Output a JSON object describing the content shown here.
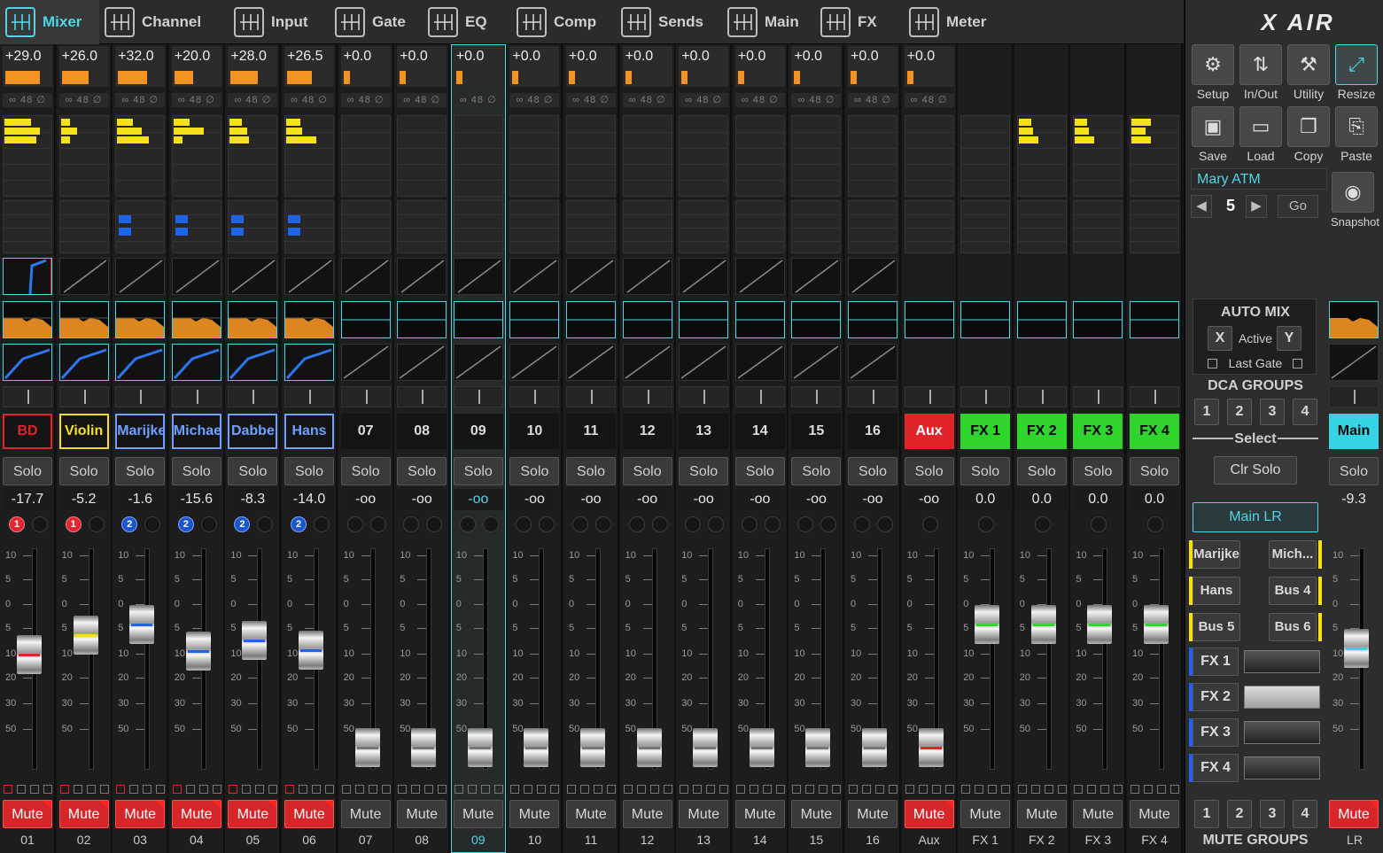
{
  "tabs": [
    {
      "label": "Mixer",
      "icon": "mixer-icon",
      "active": true
    },
    {
      "label": "Channel",
      "icon": "channel-icon"
    },
    {
      "label": "Input",
      "icon": "input-icon"
    },
    {
      "label": "Gate",
      "icon": "gate-icon"
    },
    {
      "label": "EQ",
      "icon": "eq-icon"
    },
    {
      "label": "Comp",
      "icon": "comp-icon"
    },
    {
      "label": "Sends",
      "icon": "sends-icon"
    },
    {
      "label": "Main",
      "icon": "main-icon"
    },
    {
      "label": "FX",
      "icon": "fx-icon"
    },
    {
      "label": "Meter",
      "icon": "meter-icon"
    }
  ],
  "colors": {
    "accent": "#4fd6e6",
    "red": "#e0242a",
    "yellow": "#f4e11c",
    "blue": "#1f63e6",
    "green": "#2fd52a",
    "orange": "#f39422"
  },
  "channel": {
    "phantom_label": "48",
    "solo_label": "Solo",
    "mute_label": "Mute",
    "fader_scale": [
      "10",
      "5",
      "0",
      "5",
      "10",
      "20",
      "30",
      "50"
    ]
  },
  "channels": [
    {
      "id": "01",
      "name": "BD",
      "trim": "+29.0",
      "fader": "-17.7",
      "fader_level": 0.62,
      "dca": "1",
      "dca_color": "red",
      "name_color": "#e0242a",
      "name_bg": "#141414",
      "muted": true,
      "fader_mark": "red",
      "mute_group": 1
    },
    {
      "id": "02",
      "name": "Violin",
      "trim": "+26.0",
      "fader": "-5.2",
      "fader_level": 0.75,
      "dca": "1",
      "dca_color": "red",
      "name_color": "#f4e11c",
      "name_bg": "#141414",
      "muted": true,
      "fader_mark": "yellow",
      "mute_group": 1
    },
    {
      "id": "03",
      "name": "Marijke",
      "trim": "+32.0",
      "fader": "-1.6",
      "fader_level": 0.82,
      "dca": "2",
      "dca_color": "blue",
      "name_color": "#6da0ff",
      "name_bg": "#141414",
      "muted": true,
      "fader_mark": "blue",
      "mute_group": 1
    },
    {
      "id": "04",
      "name": "Michael",
      "trim": "+20.0",
      "fader": "-15.6",
      "fader_level": 0.64,
      "dca": "2",
      "dca_color": "blue",
      "name_color": "#6da0ff",
      "name_bg": "#141414",
      "muted": true,
      "fader_mark": "blue",
      "mute_group": 1
    },
    {
      "id": "05",
      "name": "Dabbe",
      "trim": "+28.0",
      "fader": "-8.3",
      "fader_level": 0.71,
      "dca": "2",
      "dca_color": "blue",
      "name_color": "#6da0ff",
      "name_bg": "#141414",
      "muted": true,
      "fader_mark": "blue",
      "mute_group": 1
    },
    {
      "id": "06",
      "name": "Hans",
      "trim": "+26.5",
      "fader": "-14.0",
      "fader_level": 0.65,
      "dca": "2",
      "dca_color": "blue",
      "name_color": "#6da0ff",
      "name_bg": "#141414",
      "muted": true,
      "fader_mark": "blue",
      "mute_group": 1
    },
    {
      "id": "07",
      "name": "07",
      "trim": "+0.0",
      "fader": "-oo",
      "fader_level": 0,
      "muted": false
    },
    {
      "id": "08",
      "name": "08",
      "trim": "+0.0",
      "fader": "-oo",
      "fader_level": 0,
      "muted": false
    },
    {
      "id": "09",
      "name": "09",
      "trim": "+0.0",
      "fader": "-oo",
      "fader_level": 0,
      "muted": false,
      "selected": true
    },
    {
      "id": "10",
      "name": "10",
      "trim": "+0.0",
      "fader": "-oo",
      "fader_level": 0,
      "muted": false
    },
    {
      "id": "11",
      "name": "11",
      "trim": "+0.0",
      "fader": "-oo",
      "fader_level": 0,
      "muted": false
    },
    {
      "id": "12",
      "name": "12",
      "trim": "+0.0",
      "fader": "-oo",
      "fader_level": 0,
      "muted": false
    },
    {
      "id": "13",
      "name": "13",
      "trim": "+0.0",
      "fader": "-oo",
      "fader_level": 0,
      "muted": false
    },
    {
      "id": "14",
      "name": "14",
      "trim": "+0.0",
      "fader": "-oo",
      "fader_level": 0,
      "muted": false
    },
    {
      "id": "15",
      "name": "15",
      "trim": "+0.0",
      "fader": "-oo",
      "fader_level": 0,
      "muted": false
    },
    {
      "id": "16",
      "name": "16",
      "trim": "+0.0",
      "fader": "-oo",
      "fader_level": 0,
      "muted": false
    },
    {
      "id": "Aux",
      "name": "Aux",
      "trim": "+0.0",
      "fader": "-oo",
      "fader_level": 0,
      "muted": true,
      "name_color": "#ffffff",
      "name_bg": "#e0242a",
      "fader_mark": "red"
    },
    {
      "id": "FX 1",
      "name": "FX 1",
      "fader": "0.0",
      "fader_level": 0.82,
      "muted": false,
      "name_color": "#000000",
      "name_bg": "#2fd52a",
      "fader_mark": "green"
    },
    {
      "id": "FX 2",
      "name": "FX 2",
      "fader": "0.0",
      "fader_level": 0.82,
      "muted": false,
      "name_color": "#000000",
      "name_bg": "#2fd52a",
      "fader_mark": "green"
    },
    {
      "id": "FX 3",
      "name": "FX 3",
      "fader": "0.0",
      "fader_level": 0.82,
      "muted": false,
      "name_color": "#000000",
      "name_bg": "#2fd52a",
      "fader_mark": "green"
    },
    {
      "id": "FX 4",
      "name": "FX 4",
      "fader": "0.0",
      "fader_level": 0.82,
      "muted": false,
      "name_color": "#000000",
      "name_bg": "#2fd52a",
      "fader_mark": "green"
    }
  ],
  "right": {
    "logo": "X AIR",
    "tools": [
      {
        "label": "Setup",
        "icon": "gear-icon"
      },
      {
        "label": "In/Out",
        "icon": "in-out-icon"
      },
      {
        "label": "Utility",
        "icon": "wrench-icon"
      },
      {
        "label": "Resize",
        "icon": "resize-icon"
      },
      {
        "label": "Save",
        "icon": "save-icon"
      },
      {
        "label": "Load",
        "icon": "folder-icon"
      },
      {
        "label": "Copy",
        "icon": "copy-icon"
      },
      {
        "label": "Paste",
        "icon": "paste-icon"
      }
    ],
    "snapshot_name": "Mary ATM",
    "snapshot_number": "5",
    "go_label": "Go",
    "snapshot_label": "Snapshot",
    "automix": {
      "title": "AUTO MIX",
      "x": "X",
      "active": "Active",
      "y": "Y",
      "last_gate": "Last Gate"
    },
    "dca_groups_title": "DCA GROUPS",
    "dca_buttons": [
      "1",
      "2",
      "3",
      "4"
    ],
    "select_label": "Select",
    "clr_solo": "Clr Solo",
    "main_lr": "Main LR",
    "bus_buttons": [
      {
        "label": "Marijke"
      },
      {
        "label": "Mich..."
      },
      {
        "label": "Hans"
      },
      {
        "label": "Bus 4"
      },
      {
        "label": "Bus 5"
      },
      {
        "label": "Bus 6"
      }
    ],
    "fx_slots": [
      "FX 1",
      "FX 2",
      "FX 3",
      "FX 4"
    ],
    "mute_group_buttons": [
      "1",
      "2",
      "3",
      "4"
    ],
    "mute_groups_title": "MUTE GROUPS",
    "main": {
      "name": "Main",
      "solo": "Solo",
      "fader": "-9.3",
      "fader_level": 0.66,
      "mute": "Mute",
      "num": "LR"
    }
  }
}
